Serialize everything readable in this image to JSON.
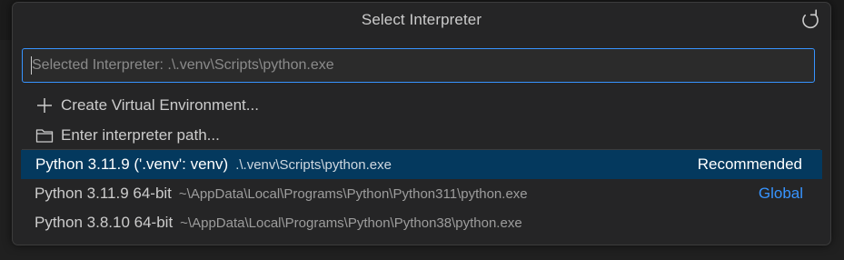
{
  "picker": {
    "title": "Select Interpreter",
    "refresh_icon": "refresh-icon",
    "search": {
      "placeholder": "Selected Interpreter: .\\.venv\\Scripts\\python.exe",
      "value": ""
    },
    "actions": [
      {
        "label": "Create Virtual Environment...",
        "icon": "plus-icon"
      },
      {
        "label": "Enter interpreter path...",
        "icon": "folder-icon"
      }
    ],
    "interpreters": [
      {
        "name": "Python 3.11.9 ('.venv': venv)",
        "path": ".\\.venv\\Scripts\\python.exe",
        "badge": "Recommended",
        "selected": true
      },
      {
        "name": "Python 3.11.9 64-bit",
        "path": "~\\AppData\\Local\\Programs\\Python\\Python311\\python.exe",
        "badge": "Global",
        "selected": false
      },
      {
        "name": "Python 3.8.10 64-bit",
        "path": "~\\AppData\\Local\\Programs\\Python\\Python38\\python.exe",
        "badge": "",
        "selected": false
      }
    ]
  },
  "colors": {
    "accent": "#3794ff",
    "selection": "#04395e",
    "background": "#252526"
  }
}
